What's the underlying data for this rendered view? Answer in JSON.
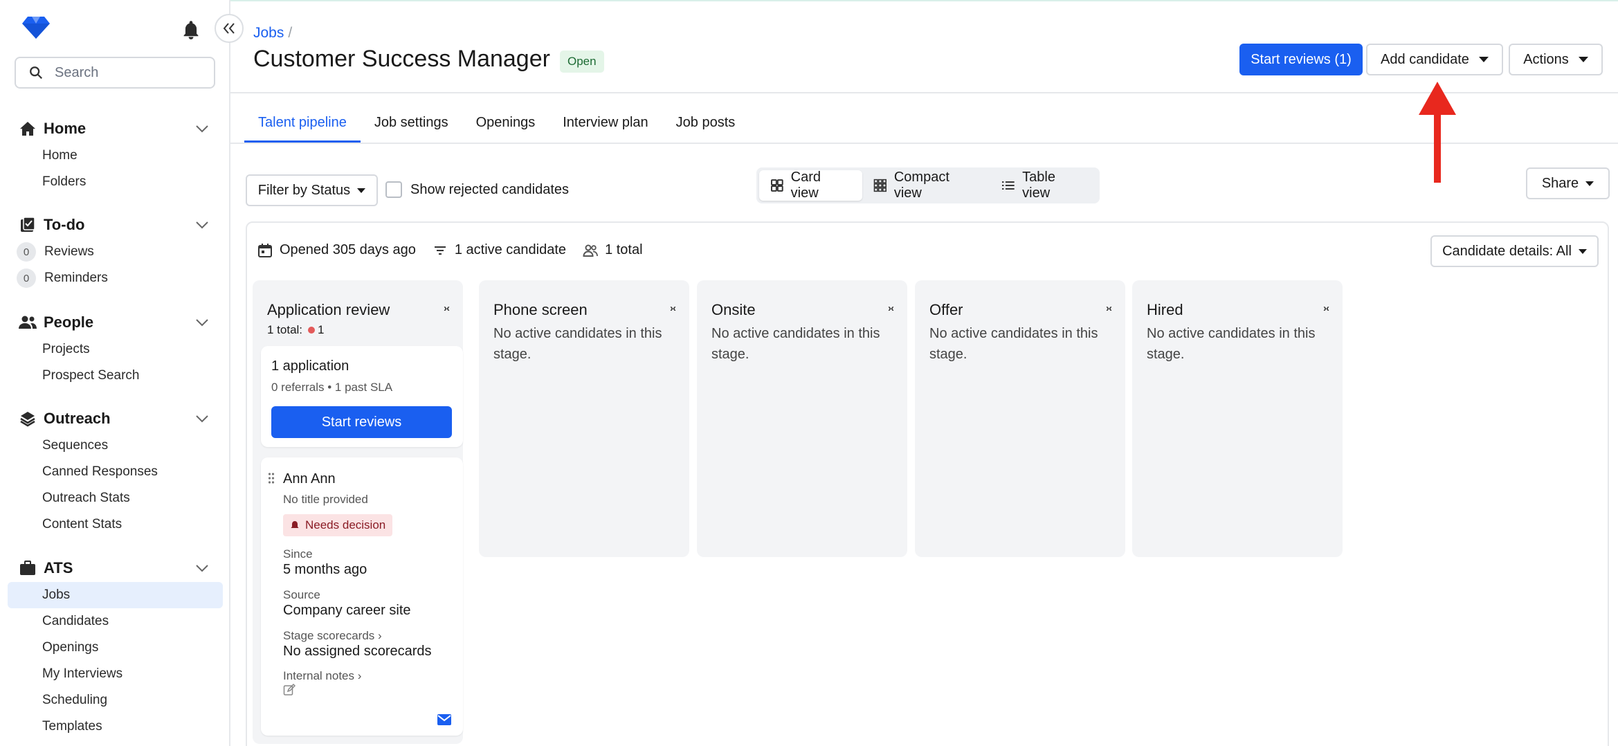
{
  "sidebar": {
    "search_placeholder": "Search",
    "sections": [
      {
        "label": "Home",
        "items": [
          "Home",
          "Folders"
        ]
      },
      {
        "label": "To-do",
        "items": [
          {
            "count": "0",
            "label": "Reviews"
          },
          {
            "count": "0",
            "label": "Reminders"
          }
        ]
      },
      {
        "label": "People",
        "items": [
          "Projects",
          "Prospect Search"
        ]
      },
      {
        "label": "Outreach",
        "items": [
          "Sequences",
          "Canned Responses",
          "Outreach Stats",
          "Content Stats"
        ]
      },
      {
        "label": "ATS",
        "items": [
          "Jobs",
          "Candidates",
          "Openings",
          "My Interviews",
          "Scheduling",
          "Templates"
        ]
      }
    ],
    "active_item": "Jobs"
  },
  "header": {
    "breadcrumb": "Jobs",
    "breadcrumb_sep": "/",
    "title": "Customer Success Manager",
    "status": "Open",
    "start_reviews": "Start reviews (1)",
    "add_candidate": "Add candidate",
    "actions": "Actions"
  },
  "tabs": [
    "Talent pipeline",
    "Job settings",
    "Openings",
    "Interview plan",
    "Job posts"
  ],
  "toolbar": {
    "filter": "Filter by Status",
    "show_rejected": "Show rejected candidates",
    "views": [
      "Card view",
      "Compact view",
      "Table view"
    ],
    "share": "Share"
  },
  "board": {
    "opened": "Opened 305 days ago",
    "active": "1 active candidate",
    "total": "1 total",
    "candidate_details": "Candidate details: All",
    "stages": [
      {
        "title": "Application review",
        "count_label": "1 total:",
        "count": "1"
      },
      {
        "title": "Phone screen",
        "empty": "No active candidates in this stage."
      },
      {
        "title": "Onsite",
        "empty": "No active candidates in this stage."
      },
      {
        "title": "Offer",
        "empty": "No active candidates in this stage."
      },
      {
        "title": "Hired",
        "empty": "No active candidates in this stage."
      }
    ],
    "collapse_glyph": "›‹",
    "summary": {
      "applications": "1 application",
      "sub": "0 referrals • 1 past SLA",
      "button": "Start reviews"
    },
    "candidate": {
      "name": "Ann Ann",
      "title": "No title provided",
      "badge": "Needs decision",
      "since_label": "Since",
      "since": "5 months ago",
      "source_label": "Source",
      "source": "Company career site",
      "scorecards_label": "Stage scorecards ›",
      "scorecards": "No assigned scorecards",
      "notes_label": "Internal notes ›"
    }
  },
  "colors": {
    "accent": "#1a5ff0",
    "annotation_arrow": "#e8281e",
    "status_open_bg": "#e4f5e8",
    "needs_decision_bg": "#fbe3e4"
  }
}
